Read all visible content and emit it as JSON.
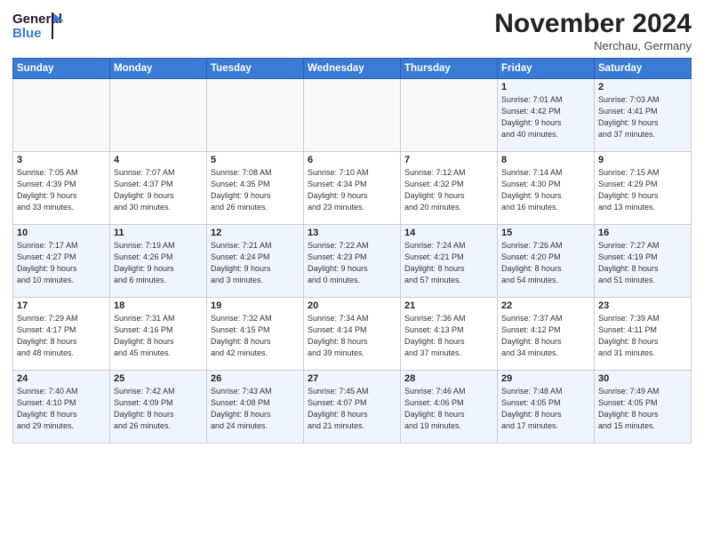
{
  "header": {
    "logo_line1": "General",
    "logo_line2": "Blue",
    "month_title": "November 2024",
    "subtitle": "Nerchau, Germany"
  },
  "days_of_week": [
    "Sunday",
    "Monday",
    "Tuesday",
    "Wednesday",
    "Thursday",
    "Friday",
    "Saturday"
  ],
  "weeks": [
    [
      {
        "day": "",
        "info": ""
      },
      {
        "day": "",
        "info": ""
      },
      {
        "day": "",
        "info": ""
      },
      {
        "day": "",
        "info": ""
      },
      {
        "day": "",
        "info": ""
      },
      {
        "day": "1",
        "info": "Sunrise: 7:01 AM\nSunset: 4:42 PM\nDaylight: 9 hours\nand 40 minutes."
      },
      {
        "day": "2",
        "info": "Sunrise: 7:03 AM\nSunset: 4:41 PM\nDaylight: 9 hours\nand 37 minutes."
      }
    ],
    [
      {
        "day": "3",
        "info": "Sunrise: 7:05 AM\nSunset: 4:39 PM\nDaylight: 9 hours\nand 33 minutes."
      },
      {
        "day": "4",
        "info": "Sunrise: 7:07 AM\nSunset: 4:37 PM\nDaylight: 9 hours\nand 30 minutes."
      },
      {
        "day": "5",
        "info": "Sunrise: 7:08 AM\nSunset: 4:35 PM\nDaylight: 9 hours\nand 26 minutes."
      },
      {
        "day": "6",
        "info": "Sunrise: 7:10 AM\nSunset: 4:34 PM\nDaylight: 9 hours\nand 23 minutes."
      },
      {
        "day": "7",
        "info": "Sunrise: 7:12 AM\nSunset: 4:32 PM\nDaylight: 9 hours\nand 20 minutes."
      },
      {
        "day": "8",
        "info": "Sunrise: 7:14 AM\nSunset: 4:30 PM\nDaylight: 9 hours\nand 16 minutes."
      },
      {
        "day": "9",
        "info": "Sunrise: 7:15 AM\nSunset: 4:29 PM\nDaylight: 9 hours\nand 13 minutes."
      }
    ],
    [
      {
        "day": "10",
        "info": "Sunrise: 7:17 AM\nSunset: 4:27 PM\nDaylight: 9 hours\nand 10 minutes."
      },
      {
        "day": "11",
        "info": "Sunrise: 7:19 AM\nSunset: 4:26 PM\nDaylight: 9 hours\nand 6 minutes."
      },
      {
        "day": "12",
        "info": "Sunrise: 7:21 AM\nSunset: 4:24 PM\nDaylight: 9 hours\nand 3 minutes."
      },
      {
        "day": "13",
        "info": "Sunrise: 7:22 AM\nSunset: 4:23 PM\nDaylight: 9 hours\nand 0 minutes."
      },
      {
        "day": "14",
        "info": "Sunrise: 7:24 AM\nSunset: 4:21 PM\nDaylight: 8 hours\nand 57 minutes."
      },
      {
        "day": "15",
        "info": "Sunrise: 7:26 AM\nSunset: 4:20 PM\nDaylight: 8 hours\nand 54 minutes."
      },
      {
        "day": "16",
        "info": "Sunrise: 7:27 AM\nSunset: 4:19 PM\nDaylight: 8 hours\nand 51 minutes."
      }
    ],
    [
      {
        "day": "17",
        "info": "Sunrise: 7:29 AM\nSunset: 4:17 PM\nDaylight: 8 hours\nand 48 minutes."
      },
      {
        "day": "18",
        "info": "Sunrise: 7:31 AM\nSunset: 4:16 PM\nDaylight: 8 hours\nand 45 minutes."
      },
      {
        "day": "19",
        "info": "Sunrise: 7:32 AM\nSunset: 4:15 PM\nDaylight: 8 hours\nand 42 minutes."
      },
      {
        "day": "20",
        "info": "Sunrise: 7:34 AM\nSunset: 4:14 PM\nDaylight: 8 hours\nand 39 minutes."
      },
      {
        "day": "21",
        "info": "Sunrise: 7:36 AM\nSunset: 4:13 PM\nDaylight: 8 hours\nand 37 minutes."
      },
      {
        "day": "22",
        "info": "Sunrise: 7:37 AM\nSunset: 4:12 PM\nDaylight: 8 hours\nand 34 minutes."
      },
      {
        "day": "23",
        "info": "Sunrise: 7:39 AM\nSunset: 4:11 PM\nDaylight: 8 hours\nand 31 minutes."
      }
    ],
    [
      {
        "day": "24",
        "info": "Sunrise: 7:40 AM\nSunset: 4:10 PM\nDaylight: 8 hours\nand 29 minutes."
      },
      {
        "day": "25",
        "info": "Sunrise: 7:42 AM\nSunset: 4:09 PM\nDaylight: 8 hours\nand 26 minutes."
      },
      {
        "day": "26",
        "info": "Sunrise: 7:43 AM\nSunset: 4:08 PM\nDaylight: 8 hours\nand 24 minutes."
      },
      {
        "day": "27",
        "info": "Sunrise: 7:45 AM\nSunset: 4:07 PM\nDaylight: 8 hours\nand 21 minutes."
      },
      {
        "day": "28",
        "info": "Sunrise: 7:46 AM\nSunset: 4:06 PM\nDaylight: 8 hours\nand 19 minutes."
      },
      {
        "day": "29",
        "info": "Sunrise: 7:48 AM\nSunset: 4:05 PM\nDaylight: 8 hours\nand 17 minutes."
      },
      {
        "day": "30",
        "info": "Sunrise: 7:49 AM\nSunset: 4:05 PM\nDaylight: 8 hours\nand 15 minutes."
      }
    ]
  ]
}
